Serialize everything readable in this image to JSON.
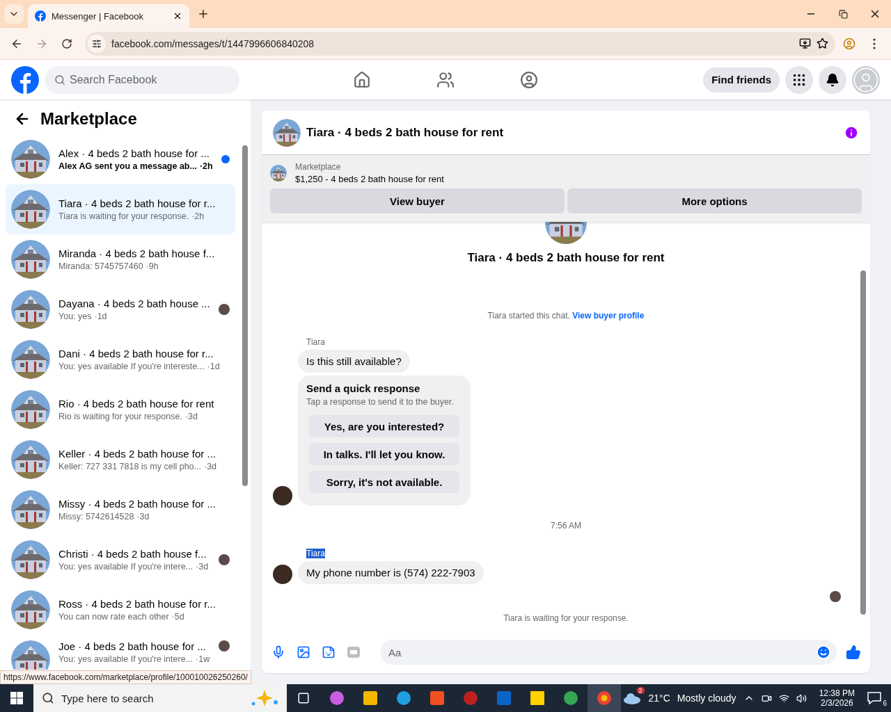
{
  "browser": {
    "tab_title": "Messenger | Facebook",
    "url": "facebook.com/messages/t/1447996606840208",
    "status_url": "https://www.facebook.com/marketplace/profile/100010026250260/"
  },
  "header": {
    "search_placeholder": "Search Facebook",
    "find_friends": "Find friends"
  },
  "sidebar": {
    "title": "Marketplace",
    "conversations": [
      {
        "title": "Alex · 4 beds 2 bath house for ...",
        "preview": "Alex AG sent you a message ab...",
        "time": "·2h",
        "unread": true,
        "selected": false,
        "seen_avatar": false
      },
      {
        "title": "Tiara · 4 beds 2 bath house for r...",
        "preview": "Tiara is waiting for your response.",
        "time": "·2h",
        "unread": false,
        "selected": true,
        "seen_avatar": false
      },
      {
        "title": "Miranda · 4 beds 2 bath house f...",
        "preview": "Miranda: 5745757460",
        "time": "·9h",
        "unread": false,
        "selected": false,
        "seen_avatar": false
      },
      {
        "title": "Dayana · 4 beds 2 bath house ...",
        "preview": "You: yes",
        "time": "·1d",
        "unread": false,
        "selected": false,
        "seen_avatar": true
      },
      {
        "title": "Dani · 4 beds 2 bath house for r...",
        "preview": "You: yes available If you're intereste...",
        "time": "·1d",
        "unread": false,
        "selected": false,
        "seen_avatar": false
      },
      {
        "title": "Rio · 4 beds 2 bath house for rent",
        "preview": "Rio is waiting for your response.",
        "time": "·3d",
        "unread": false,
        "selected": false,
        "seen_avatar": false
      },
      {
        "title": "Keller · 4 beds 2 bath house for ...",
        "preview": "Keller: 727 331 7818 is my cell pho...",
        "time": "·3d",
        "unread": false,
        "selected": false,
        "seen_avatar": false
      },
      {
        "title": "Missy · 4 beds 2 bath house for ...",
        "preview": "Missy: 5742614528",
        "time": "·3d",
        "unread": false,
        "selected": false,
        "seen_avatar": false
      },
      {
        "title": "Christi · 4 beds 2 bath house f...",
        "preview": "You: yes available If you're intere...",
        "time": "·3d",
        "unread": false,
        "selected": false,
        "seen_avatar": true
      },
      {
        "title": "Ross · 4 beds 2 bath house for r...",
        "preview": "You can now rate each other",
        "time": "·5d",
        "unread": false,
        "selected": false,
        "seen_avatar": false
      },
      {
        "title": "Joe · 4 beds 2 bath house for ...",
        "preview": "You: yes available If you're intere...",
        "time": "·1w",
        "unread": false,
        "selected": false,
        "seen_avatar": true
      }
    ]
  },
  "chat": {
    "title": "Tiara · 4 beds 2 bath house for rent",
    "listing_label": "Marketplace",
    "listing_title": "$1,250 - 4 beds 2 bath house for rent",
    "buttons": [
      "View buyer",
      "More options"
    ],
    "intro_title": "Tiara · 4 beds 2 bath house for rent",
    "started_text": "Tiara started this chat.",
    "profile_link": "View buyer profile",
    "first_sender": "Tiara",
    "first_message": "Is this still available?",
    "quick_response": {
      "title": "Send a quick response",
      "subtitle": "Tap a response to send it to the buyer.",
      "options": [
        "Yes, are you interested?",
        "In talks. I'll let you know.",
        "Sorry, it's not available."
      ]
    },
    "time": "7:56 AM",
    "second_sender": "Tiara",
    "second_sender_highlighted": true,
    "second_message": "My phone number is (574) 222-7903",
    "status": "Tiara is waiting for your response.",
    "composer_placeholder": "Aa"
  },
  "taskbar": {
    "search_placeholder": "Type here to search",
    "weather_badge": "2",
    "temperature": "21°C",
    "condition": "Mostly cloudy",
    "time": "12:38 PM",
    "date": "2/3/2026",
    "notifications": "6"
  }
}
